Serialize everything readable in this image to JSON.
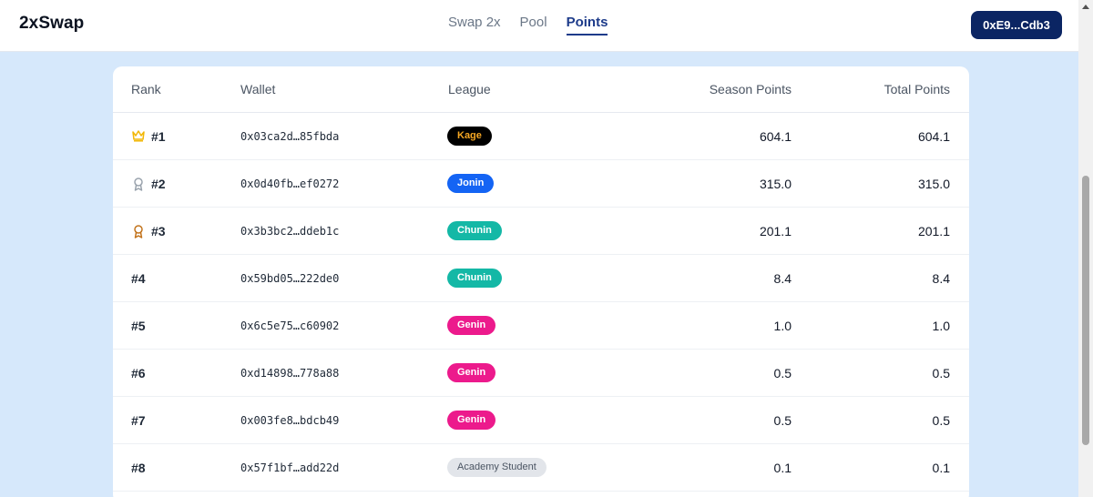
{
  "header": {
    "brand": "2xSwap",
    "tabs": [
      {
        "label": "Swap 2x",
        "active": false
      },
      {
        "label": "Pool",
        "active": false
      },
      {
        "label": "Points",
        "active": true
      }
    ],
    "wallet_button": "0xE9...Cdb3"
  },
  "table": {
    "columns": {
      "rank": "Rank",
      "wallet": "Wallet",
      "league": "League",
      "season_points": "Season Points",
      "total_points": "Total Points"
    },
    "rows": [
      {
        "rank": "#1",
        "icon": "crown-icon",
        "wallet": "0x03ca2d…85fbda",
        "league": "Kage",
        "season": "604.1",
        "total": "604.1"
      },
      {
        "rank": "#2",
        "icon": "medal-icon",
        "wallet": "0x0d40fb…ef0272",
        "league": "Jonin",
        "season": "315.0",
        "total": "315.0"
      },
      {
        "rank": "#3",
        "icon": "medal-icon",
        "wallet": "0x3b3bc2…ddeb1c",
        "league": "Chunin",
        "season": "201.1",
        "total": "201.1"
      },
      {
        "rank": "#4",
        "icon": "",
        "wallet": "0x59bd05…222de0",
        "league": "Chunin",
        "season": "8.4",
        "total": "8.4"
      },
      {
        "rank": "#5",
        "icon": "",
        "wallet": "0x6c5e75…c60902",
        "league": "Genin",
        "season": "1.0",
        "total": "1.0"
      },
      {
        "rank": "#6",
        "icon": "",
        "wallet": "0xd14898…778a88",
        "league": "Genin",
        "season": "0.5",
        "total": "0.5"
      },
      {
        "rank": "#7",
        "icon": "",
        "wallet": "0x003fe8…bdcb49",
        "league": "Genin",
        "season": "0.5",
        "total": "0.5"
      },
      {
        "rank": "#8",
        "icon": "",
        "wallet": "0x57f1bf…add22d",
        "league": "Academy Student",
        "season": "0.1",
        "total": "0.1"
      }
    ]
  },
  "colors": {
    "page_bg": "#d6e8fb",
    "wallet_button_bg": "#0b2563",
    "active_tab": "#1d3b8a",
    "league_kage_bg": "#000000",
    "league_kage_text": "#f5a623",
    "league_jonin_bg": "#1464f4",
    "league_chunin_bg": "#14b8a6",
    "league_genin_bg": "#ec1a8c",
    "league_academy_bg": "#e2e5ea",
    "league_academy_text": "#4b5563",
    "crown_color": "#f2b705",
    "silver_medal": "#9aa3ad",
    "bronze_medal": "#c2731c"
  }
}
